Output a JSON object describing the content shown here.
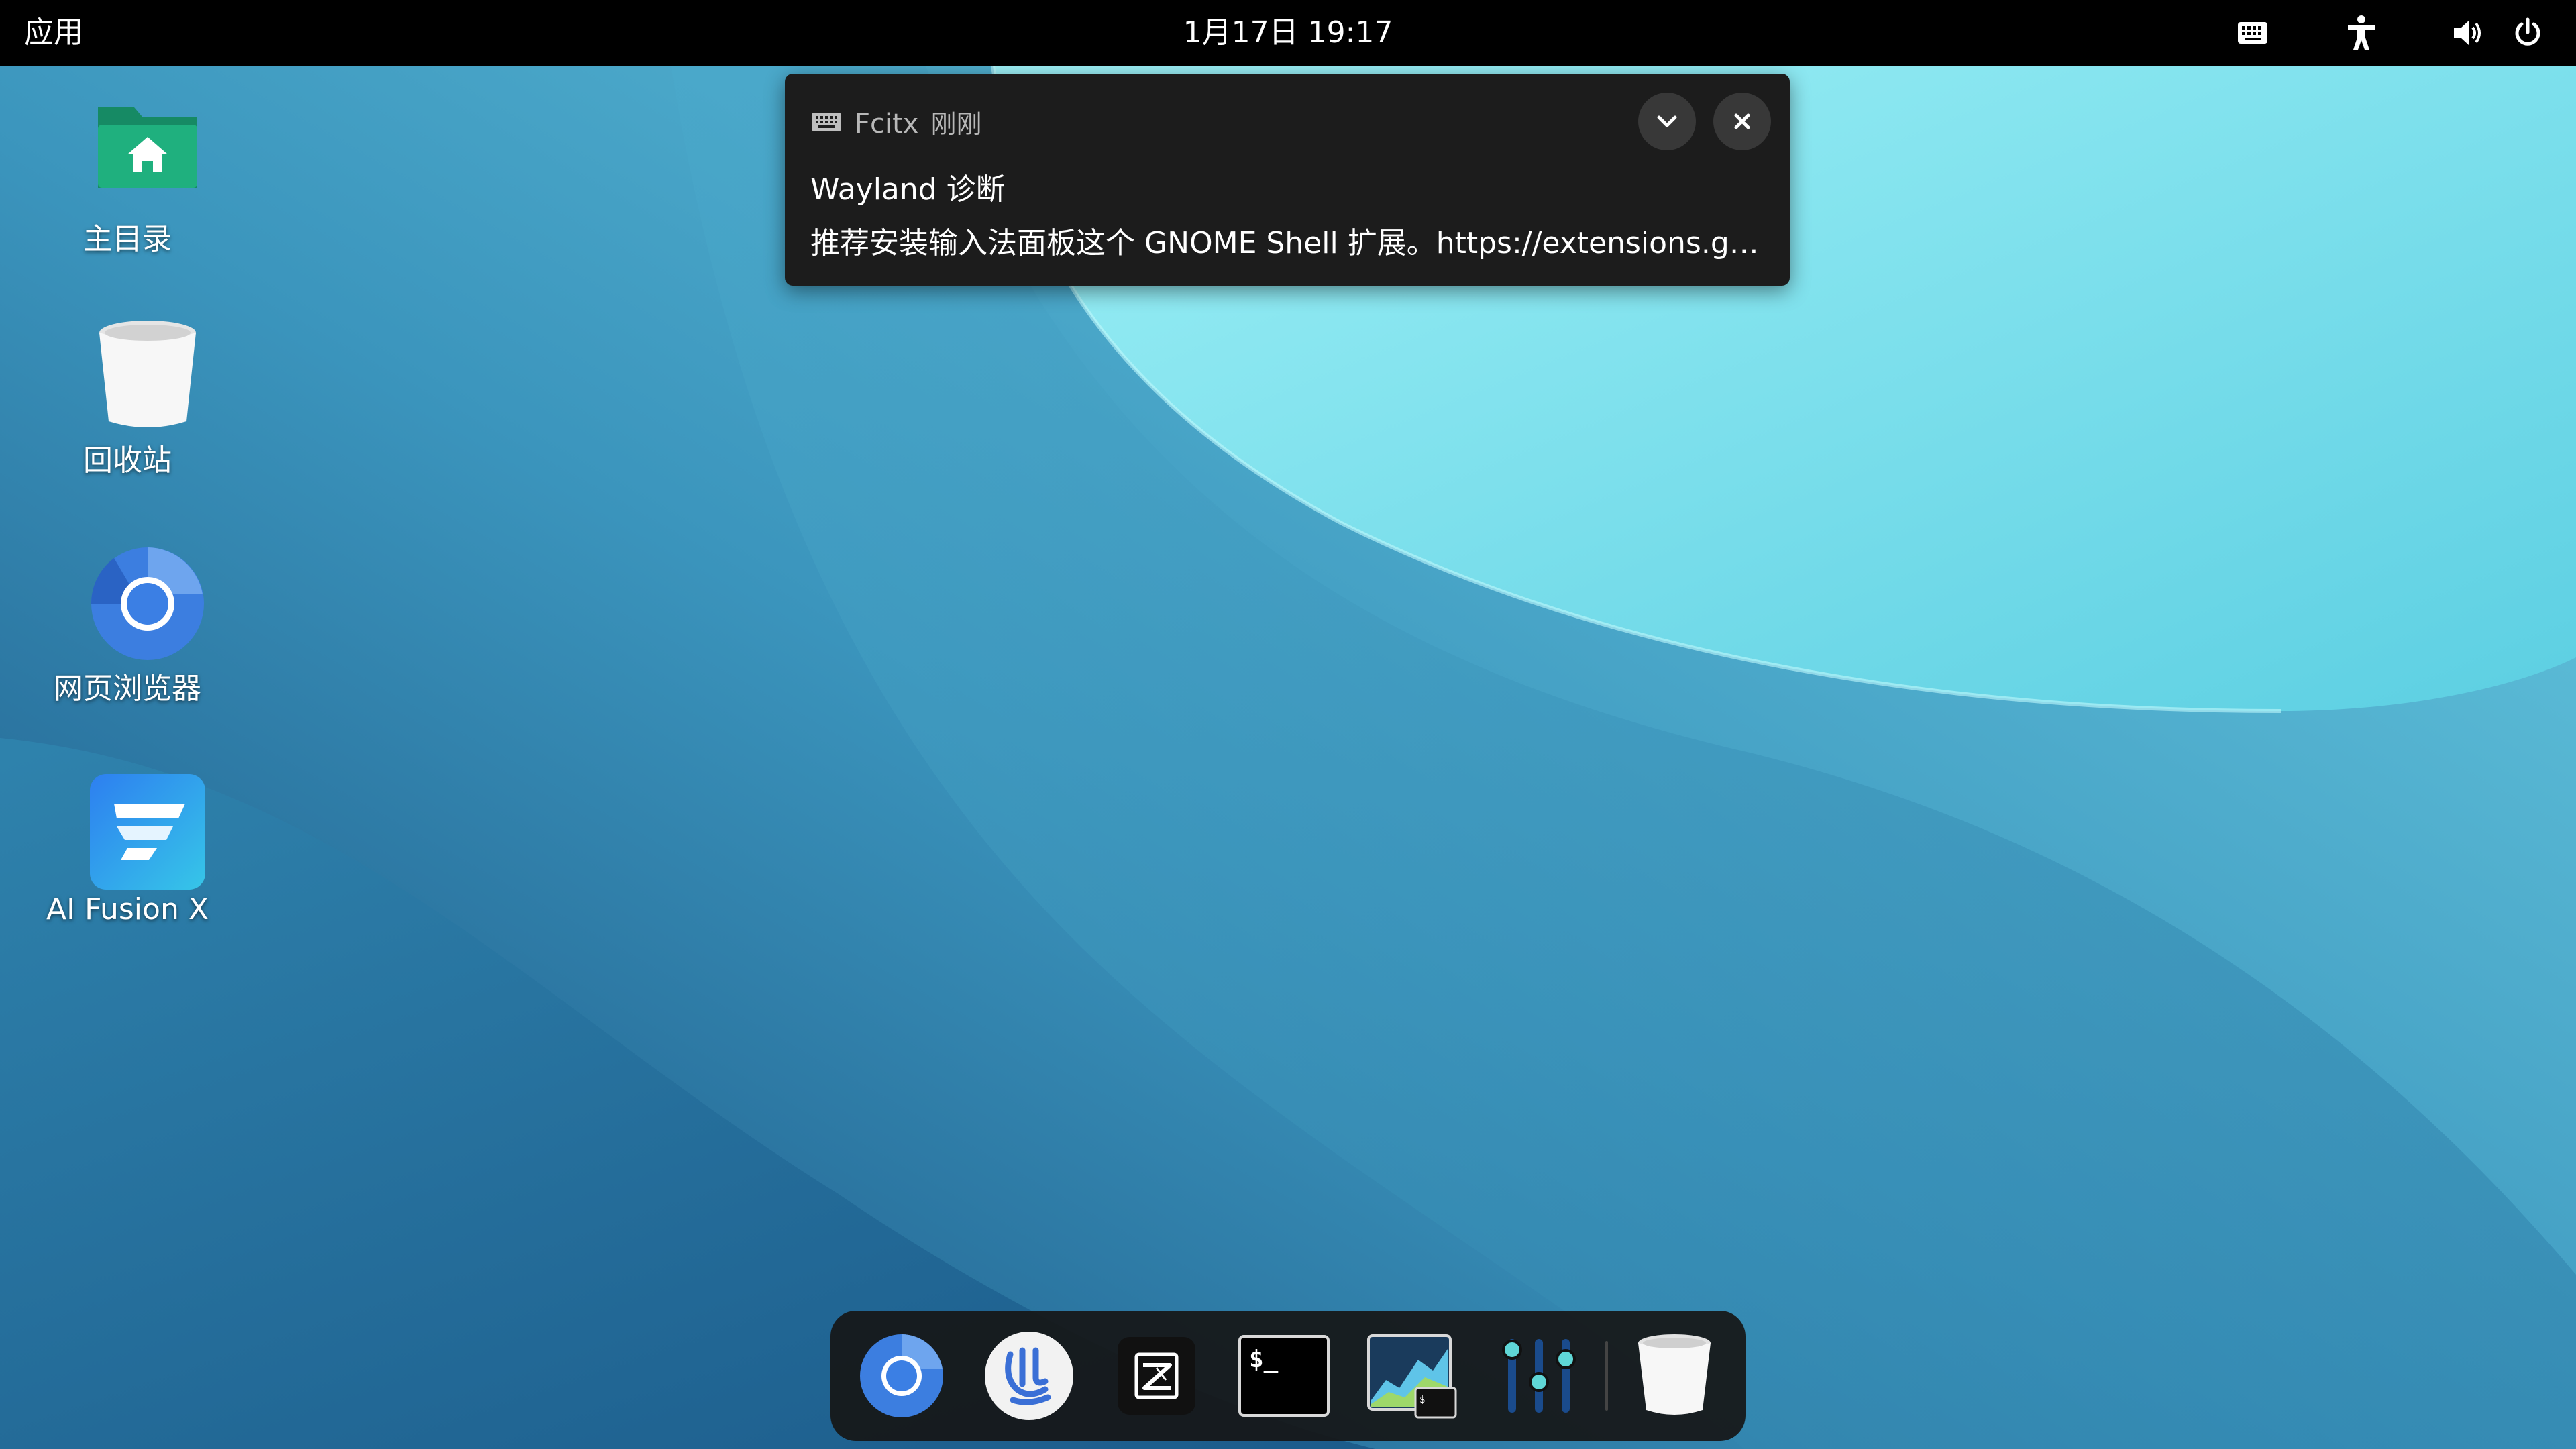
{
  "topbar": {
    "apps_label": "应用",
    "clock": "1月17日  19:17",
    "tray_icons": [
      "keyboard-icon",
      "accessibility-icon",
      "volume-icon",
      "power-icon"
    ]
  },
  "desktop": {
    "icons": [
      {
        "label": "主目录",
        "icon": "home-folder-icon"
      },
      {
        "label": "回收站",
        "icon": "trash-icon"
      },
      {
        "label": "网页浏览器",
        "icon": "chromium-icon"
      },
      {
        "label": "AI Fusion X",
        "icon": "ai-fusion-icon"
      }
    ]
  },
  "notification": {
    "app": "Fcitx",
    "time": "刚刚",
    "title": "Wayland 诊断",
    "body": "推荐安装输入法面板这个 GNOME Shell 扩展。https://extensions.gno…",
    "expand_icon": "chevron-down-icon",
    "close_icon": "close-icon"
  },
  "dock": {
    "items": [
      "chromium-icon",
      "software-store-icon",
      "text-editor-icon",
      "terminal-icon",
      "system-monitor-icon",
      "mixer-settings-icon",
      "trash-icon"
    ]
  },
  "colors": {
    "topbar": "#000000",
    "notification_bg": "#1c1c1c",
    "dock_bg": "#161616",
    "wall_dark": "#1f5e8e",
    "wall_light": "#8ee9f3"
  }
}
